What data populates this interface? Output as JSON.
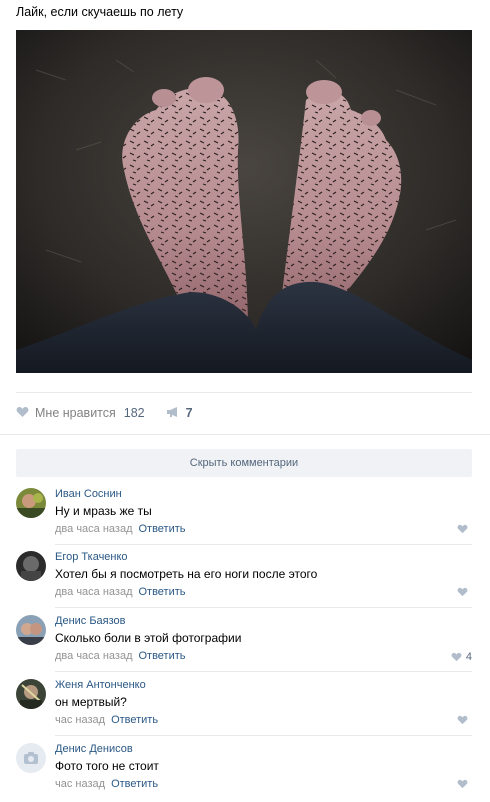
{
  "post": {
    "text": "Лайк, если скучаешь по лету",
    "photo_icon": "photo-feet-with-mosquitoes"
  },
  "actions": {
    "like_label": "Мне нравится",
    "like_count": "182",
    "share_count": "7"
  },
  "comments_toggle": "Скрыть комментарии",
  "comments": [
    {
      "author": "Иван Соснин",
      "text": "Ну и мразь же ты",
      "time": "два часа назад",
      "reply": "Ответить",
      "likes": ""
    },
    {
      "author": "Егор Ткаченко",
      "text": "Хотел бы я посмотреть на его ноги после этого",
      "time": "два часа назад",
      "reply": "Ответить",
      "likes": ""
    },
    {
      "author": "Денис Баязов",
      "text": "Сколько боли в этой фотографии",
      "time": "два часа назад",
      "reply": "Ответить",
      "likes": "4"
    },
    {
      "author": "Женя Антонченко",
      "text": "он мертвый?",
      "time": "час назад",
      "reply": "Ответить",
      "likes": ""
    },
    {
      "author": "Денис Денисов",
      "text": "Фото того не стоит",
      "time": "час назад",
      "reply": "Ответить",
      "likes": ""
    }
  ],
  "colors": {
    "link": "#2a5885",
    "muted": "#939393",
    "divider": "#e7e8ec",
    "button_bg": "#f0f2f5"
  }
}
